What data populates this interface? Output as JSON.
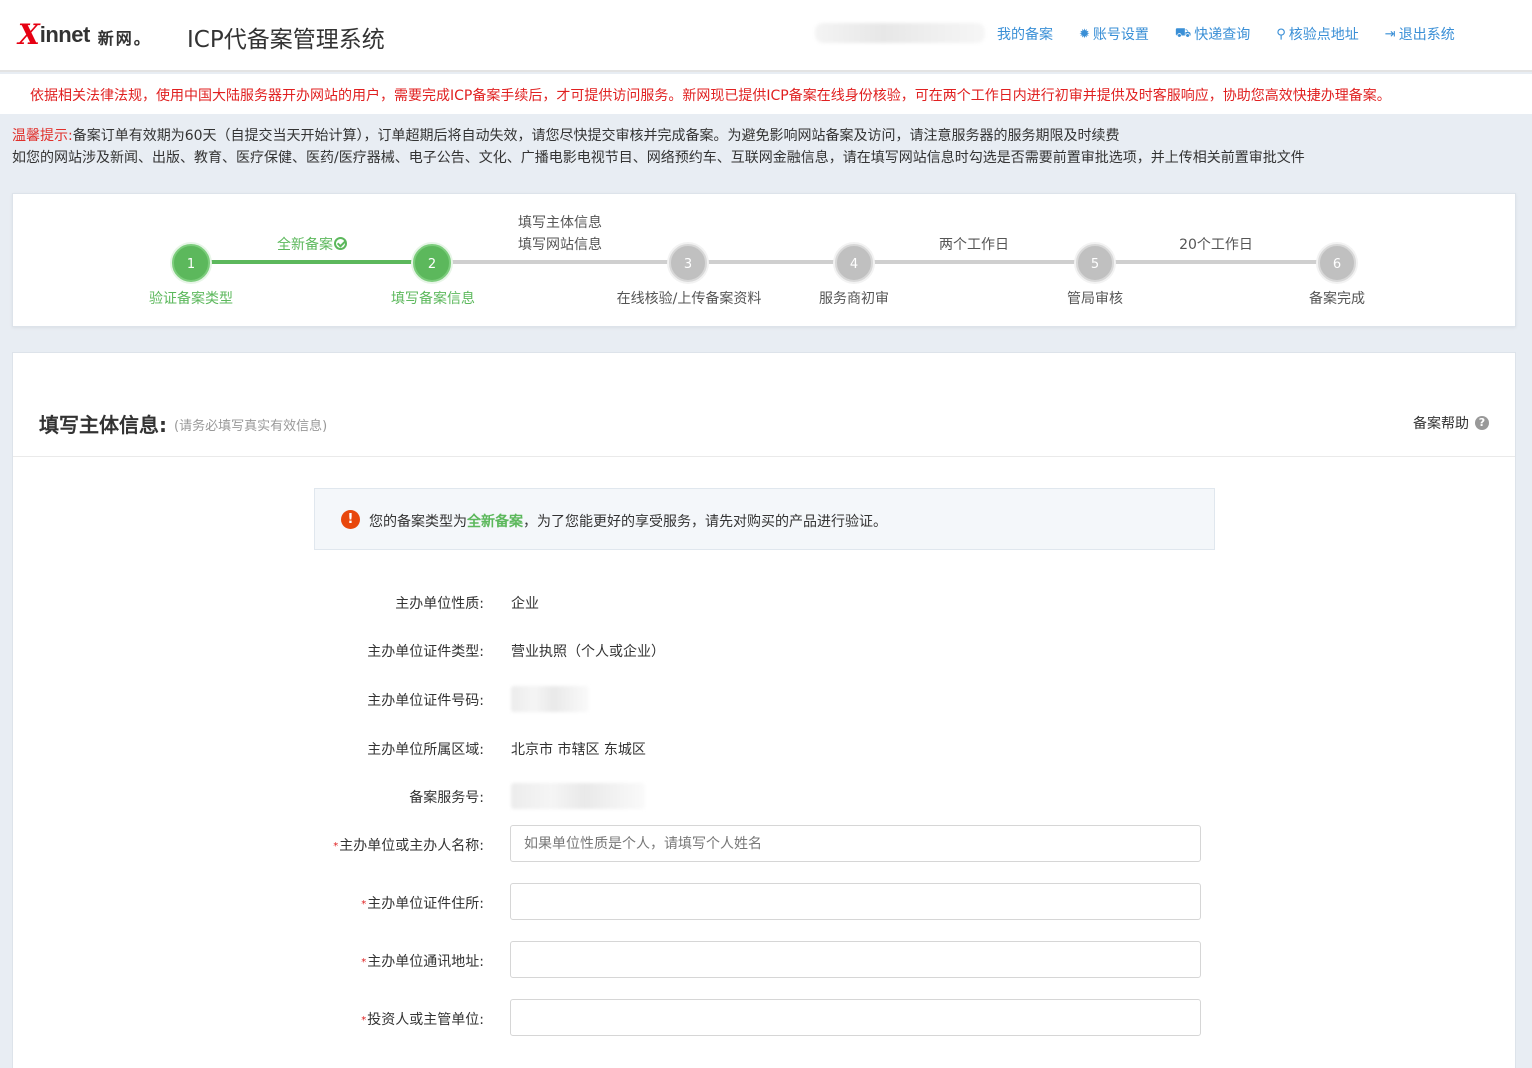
{
  "header": {
    "logo_x": "X",
    "logo_innet": "innet",
    "logo_cn": "新网。",
    "title": "ICP代备案管理系统",
    "nav": [
      {
        "label": "我的备案",
        "icon": "none"
      },
      {
        "label": "账号设置",
        "icon": "gear-icon"
      },
      {
        "label": "快递查询",
        "icon": "truck-icon"
      },
      {
        "label": "核验点地址",
        "icon": "map-marker-icon"
      },
      {
        "label": "退出系统",
        "icon": "sign-out-icon"
      }
    ]
  },
  "notice": "依据相关法律法规，使用中国大陆服务器开办网站的用户，需要完成ICP备案手续后，才可提供访问服务。新网现已提供ICP备案在线身份核验，可在两个工作日内进行初审并提供及时客服响应，协助您高效快捷办理备案。",
  "tips": {
    "label": "温馨提示:",
    "line1": "备案订单有效期为60天（自提交当天开始计算），订单超期后将自动失效，请您尽快提交审核并完成备案。为避免影响网站备案及访问，请注意服务器的服务期限及时续费",
    "line2": "如您的网站涉及新闻、出版、教育、医疗保健、医药/医疗器械、电子公告、文化、广播电影电视节目、网络预约车、互联网金融信息，请在填写网站信息时勾选是否需要前置审批选项，并上传相关前置审批文件"
  },
  "steps": [
    {
      "num": "1",
      "label": "验证备案类型",
      "status": "done"
    },
    {
      "num": "2",
      "label": "填写备案信息",
      "status": "done"
    },
    {
      "num": "3",
      "label": "在线核验/上传备案资料",
      "status": "todo"
    },
    {
      "num": "4",
      "label": "服务商初审",
      "status": "todo"
    },
    {
      "num": "5",
      "label": "管局审核",
      "status": "todo"
    },
    {
      "num": "6",
      "label": "备案完成",
      "status": "todo"
    }
  ],
  "step_connectors": {
    "c1": "全新备案",
    "c2_line1": "填写主体信息",
    "c2_line2": "填写网站信息",
    "c4": "两个工作日",
    "c5": "20个工作日"
  },
  "form": {
    "title": "填写主体信息:",
    "subtitle": "(请务必填写真实有效信息)",
    "help": "备案帮助",
    "alert_prefix": "您的备案类型为",
    "alert_type": "全新备案",
    "alert_suffix": "，为了您能更好的享受服务，请先对购买的产品进行验证。",
    "fields": {
      "nature_label": "主办单位性质:",
      "nature_value": "企业",
      "cert_type_label": "主办单位证件类型:",
      "cert_type_value": "营业执照（个人或企业）",
      "cert_no_label": "主办单位证件号码:",
      "region_label": "主办单位所属区域:",
      "region_value": "北京市 市辖区 东城区",
      "service_no_label": "备案服务号:",
      "name_label": "主办单位或主办人名称:",
      "name_placeholder": "如果单位性质是个人，请填写个人姓名",
      "cert_addr_label": "主办单位证件住所:",
      "mail_addr_label": "主办单位通讯地址:",
      "investor_label": "投资人或主管单位:",
      "required_mark": "*"
    }
  }
}
